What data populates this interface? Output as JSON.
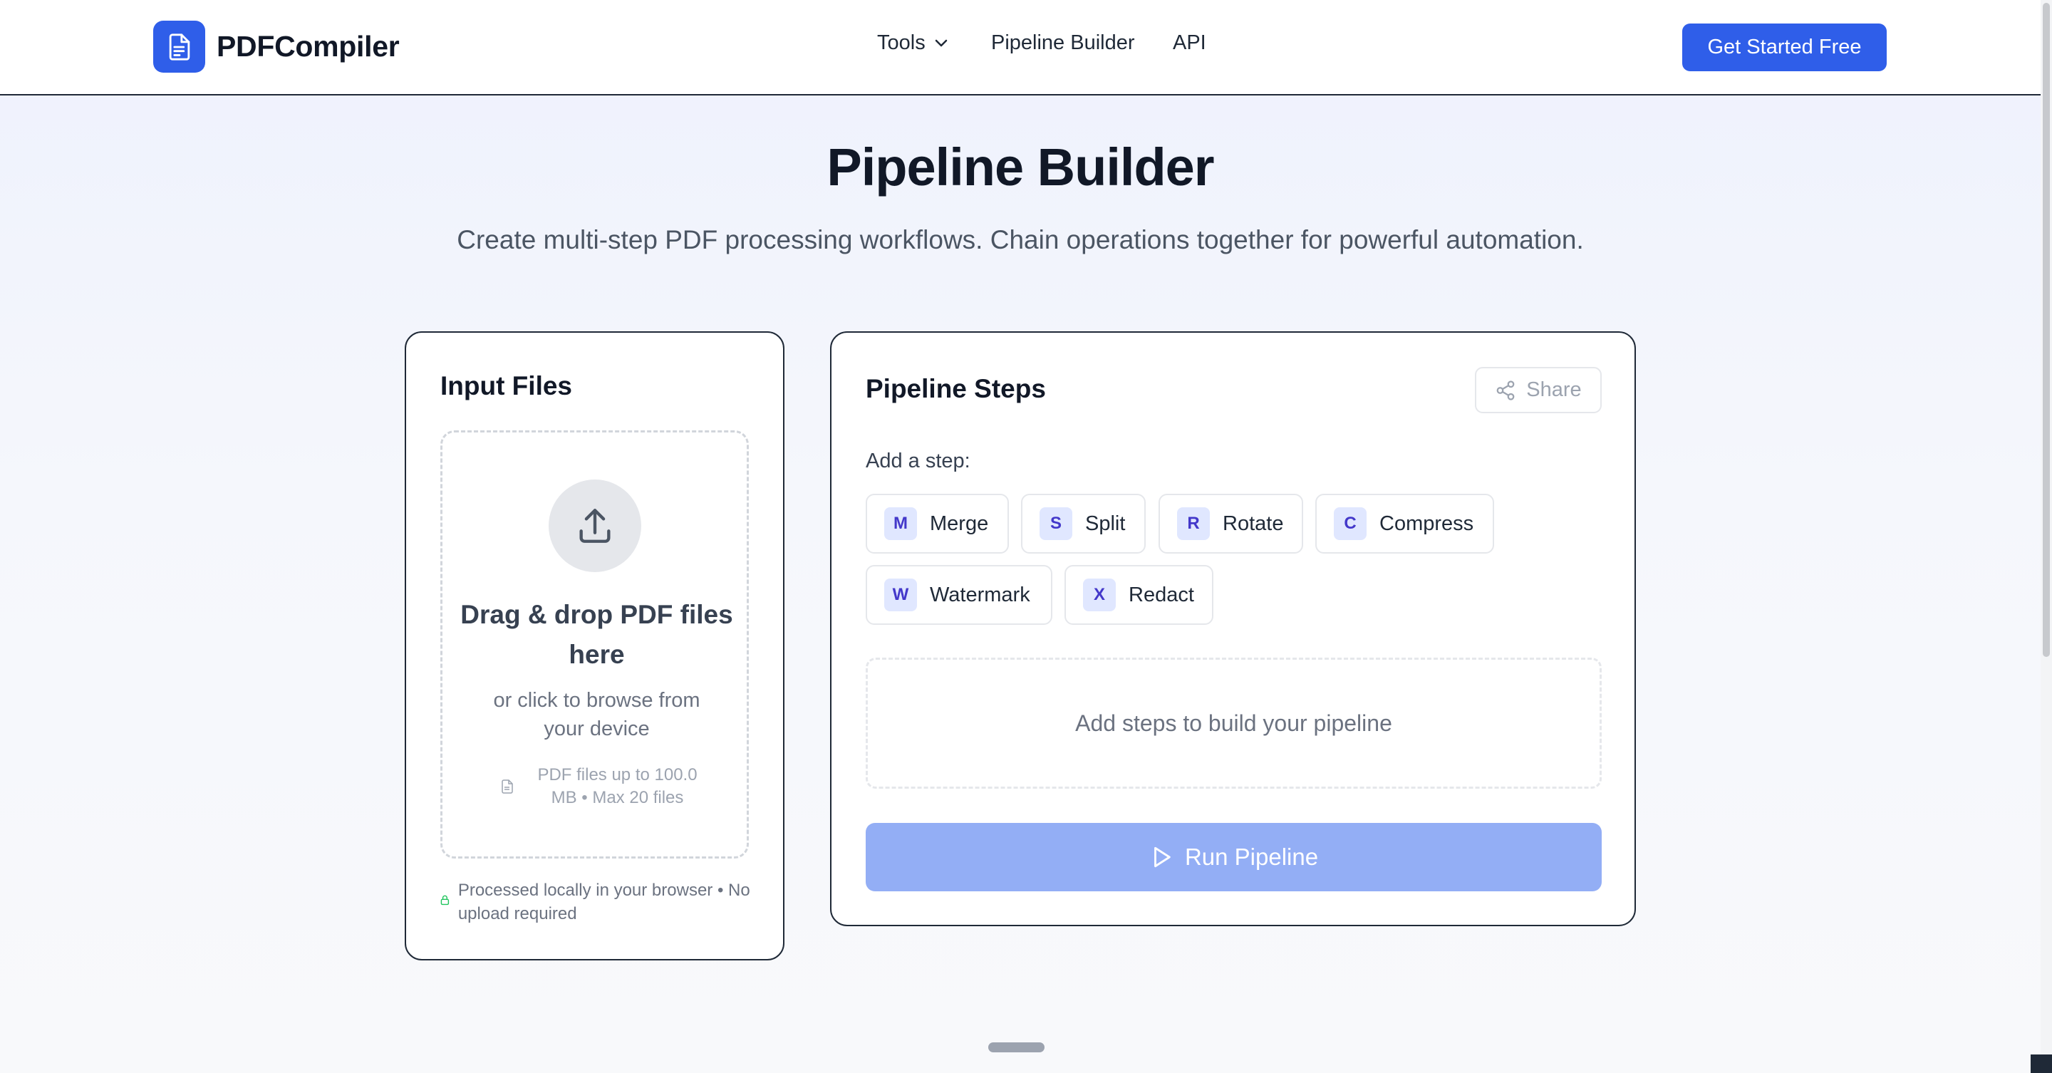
{
  "header": {
    "brand": "PDFCompiler",
    "nav": {
      "tools": "Tools",
      "pipeline_builder": "Pipeline Builder",
      "api": "API"
    },
    "cta": "Get Started Free"
  },
  "hero": {
    "title": "Pipeline Builder",
    "subtitle": "Create multi-step PDF processing workflows. Chain operations together for powerful automation."
  },
  "input_files": {
    "title": "Input Files",
    "dropzone": {
      "title": "Drag & drop PDF files here",
      "subtitle": "or click to browse from your device",
      "limits": "PDF files up to 100.0 MB • Max 20 files"
    },
    "local_note": "Processed locally in your browser • No upload required"
  },
  "pipeline_steps": {
    "title": "Pipeline Steps",
    "share": "Share",
    "add_label": "Add a step:",
    "steps": [
      {
        "letter": "M",
        "label": "Merge"
      },
      {
        "letter": "S",
        "label": "Split"
      },
      {
        "letter": "R",
        "label": "Rotate"
      },
      {
        "letter": "C",
        "label": "Compress"
      },
      {
        "letter": "W",
        "label": "Watermark"
      },
      {
        "letter": "X",
        "label": "Redact"
      }
    ],
    "empty_message": "Add steps to build your pipeline",
    "run": "Run Pipeline"
  },
  "colors": {
    "primary": "#2f5ee9",
    "primary_disabled": "#93aef5",
    "step_badge_bg": "#e0e7ff",
    "step_badge_text": "#4338ca",
    "lock_green": "#22c55e"
  },
  "icons": {
    "logo": "document-icon",
    "tools_caret": "chevron-down-icon",
    "upload": "upload-icon",
    "file": "file-icon",
    "lock": "lock-icon",
    "share": "share-icon",
    "run": "play-icon"
  }
}
